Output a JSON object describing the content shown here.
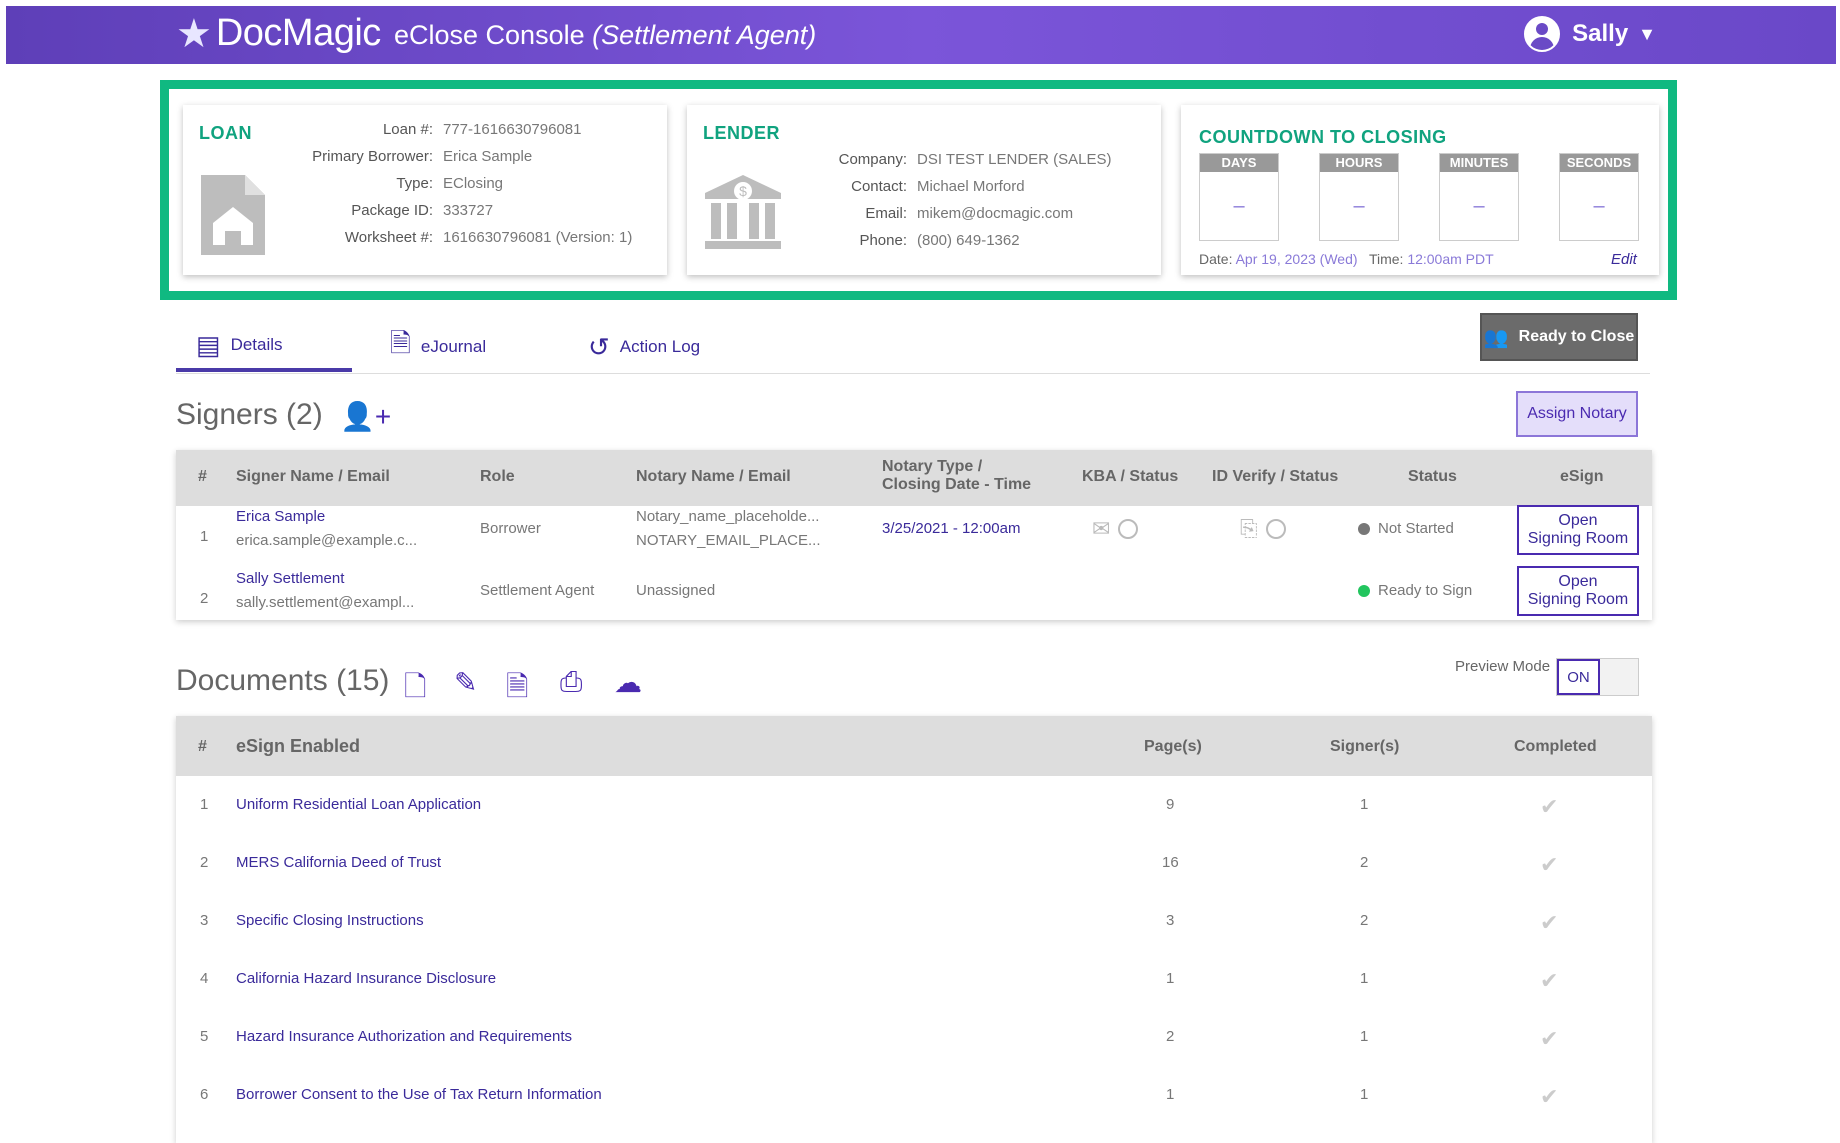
{
  "header": {
    "logo": "DocMagic",
    "console_title": "eClose Console",
    "console_role": "(Settlement Agent)",
    "user_name": "Sally"
  },
  "loan": {
    "title": "LOAN",
    "fields": [
      {
        "label": "Loan #:",
        "value": "777-1616630796081"
      },
      {
        "label": "Primary Borrower:",
        "value": "Erica Sample"
      },
      {
        "label": "Type:",
        "value": "EClosing"
      },
      {
        "label": "Package ID:",
        "value": "333727"
      },
      {
        "label": "Worksheet #:",
        "value": "1616630796081 (Version: 1)"
      }
    ]
  },
  "lender": {
    "title": "LENDER",
    "fields": [
      {
        "label": "Company:",
        "value": "DSI TEST LENDER (SALES)"
      },
      {
        "label": "Contact:",
        "value": "Michael Morford"
      },
      {
        "label": "Email:",
        "value": "mikem@docmagic.com"
      },
      {
        "label": "Phone:",
        "value": "(800) 649-1362"
      }
    ]
  },
  "countdown": {
    "title": "COUNTDOWN TO CLOSING",
    "units": [
      {
        "label": "DAYS",
        "value": "–"
      },
      {
        "label": "HOURS",
        "value": "–"
      },
      {
        "label": "MINUTES",
        "value": "–"
      },
      {
        "label": "SECONDS",
        "value": "–"
      }
    ],
    "date_label": "Date:",
    "date_value": "Apr 19, 2023 (Wed)",
    "time_label": "Time:",
    "time_value": "12:00am PDT",
    "edit_label": "Edit"
  },
  "tabs": [
    {
      "label": "Details",
      "icon": "id-card-icon"
    },
    {
      "label": "eJournal",
      "icon": "journal-icon"
    },
    {
      "label": "Action Log",
      "icon": "history-icon"
    }
  ],
  "ready_button": "Ready to Close",
  "signers": {
    "title": "Signers (2)",
    "assign_label": "Assign Notary",
    "columns": [
      "#",
      "Signer Name / Email",
      "Role",
      "Notary Name / Email",
      "Notary Type /",
      "Closing Date - Time",
      "KBA / Status",
      "ID Verify / Status",
      "Status",
      "eSign"
    ],
    "rows": [
      {
        "num": "1",
        "name": "Erica Sample",
        "email": "erica.sample@example.c...",
        "role": "Borrower",
        "notary_name": "Notary_name_placeholde...",
        "notary_email": "NOTARY_EMAIL_PLACE...",
        "closing": "3/25/2021 - 12:00am",
        "status": "Not Started",
        "status_color": "#777777",
        "esign_line1": "Open",
        "esign_line2": "Signing Room"
      },
      {
        "num": "2",
        "name": "Sally Settlement",
        "email": "sally.settlement@exampl...",
        "role": "Settlement Agent",
        "notary_name": "Unassigned",
        "notary_email": "",
        "closing": "",
        "status": "Ready to Sign",
        "status_color": "#22c55e",
        "esign_line1": "Open",
        "esign_line2": "Signing Room"
      }
    ]
  },
  "documents": {
    "title": "Documents (15)",
    "preview_label": "Preview Mode",
    "toggle_label": "ON",
    "columns": [
      "#",
      "eSign Enabled",
      "Page(s)",
      "Signer(s)",
      "Completed"
    ],
    "rows": [
      {
        "num": "1",
        "name": "Uniform Residential Loan Application",
        "pages": "9",
        "signers": "1"
      },
      {
        "num": "2",
        "name": "MERS California Deed of Trust",
        "pages": "16",
        "signers": "2"
      },
      {
        "num": "3",
        "name": "Specific Closing Instructions",
        "pages": "3",
        "signers": "2"
      },
      {
        "num": "4",
        "name": "California Hazard Insurance Disclosure",
        "pages": "1",
        "signers": "1"
      },
      {
        "num": "5",
        "name": "Hazard Insurance Authorization and Requirements",
        "pages": "2",
        "signers": "1"
      },
      {
        "num": "6",
        "name": "Borrower Consent to the Use of Tax Return Information",
        "pages": "1",
        "signers": "1"
      }
    ]
  }
}
